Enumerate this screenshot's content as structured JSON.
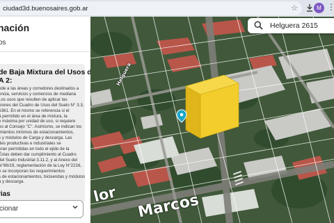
{
  "browser": {
    "url": "ciudad3d.buenosaires.gob.ar",
    "profile_initial": "M"
  },
  "panel": {
    "title": "nación",
    "subtitle": "os",
    "card_title_line1": "de Baja Mixtura del Usos de",
    "card_title_line2": "A 2:",
    "card_body": [
      "nde a las áreas y corredores destinados a",
      "encia, servicios y comercios de mediana",
      "Los usos que resulten de aplicar las",
      "ciones del Cuadro de Usos del Suelo N° 3.3,",
      "6361. En el mismo se referencia si el",
      "á permitido en el área de mixtura, la",
      "e máxima por unidad de uso, si requiere",
      "no al Consejo \"C\". Asimismo, se indican los",
      "imientos mínimos de estacionamientos,",
      "s y módulos de Carga y descarga. Las",
      "des productivas e industriales se",
      "eran permitidas en todo el ejido de la",
      "Éstas deben dar cumplimiento al Cuadro",
      "del Suelo Industrial 3.11.2, y al Anexo del",
      "N°86/19, reglamentación de la Ley N°2216,",
      "e se incorporan los requerimientos",
      "s de estacionamientos, bicisendas y módulos",
      "a y descarga."
    ],
    "section_label": "rias",
    "select_value": "cionar"
  },
  "map": {
    "search_value": "Helguera 2615",
    "street_label_1": "lor",
    "street_label_2": "Marcos",
    "street_label_3": "Helguera",
    "colors": {
      "building": "#f2cd2b",
      "pin": "#1aa5c8",
      "vegetation": "#3f5a3a"
    }
  },
  "icons": {
    "star": "bookmark-star-icon",
    "ext1": "puzzle-extension-icon",
    "ext2": "download-icon",
    "menu": "kebab-menu-icon",
    "search": "search-icon",
    "pin": "location-pin-icon"
  }
}
